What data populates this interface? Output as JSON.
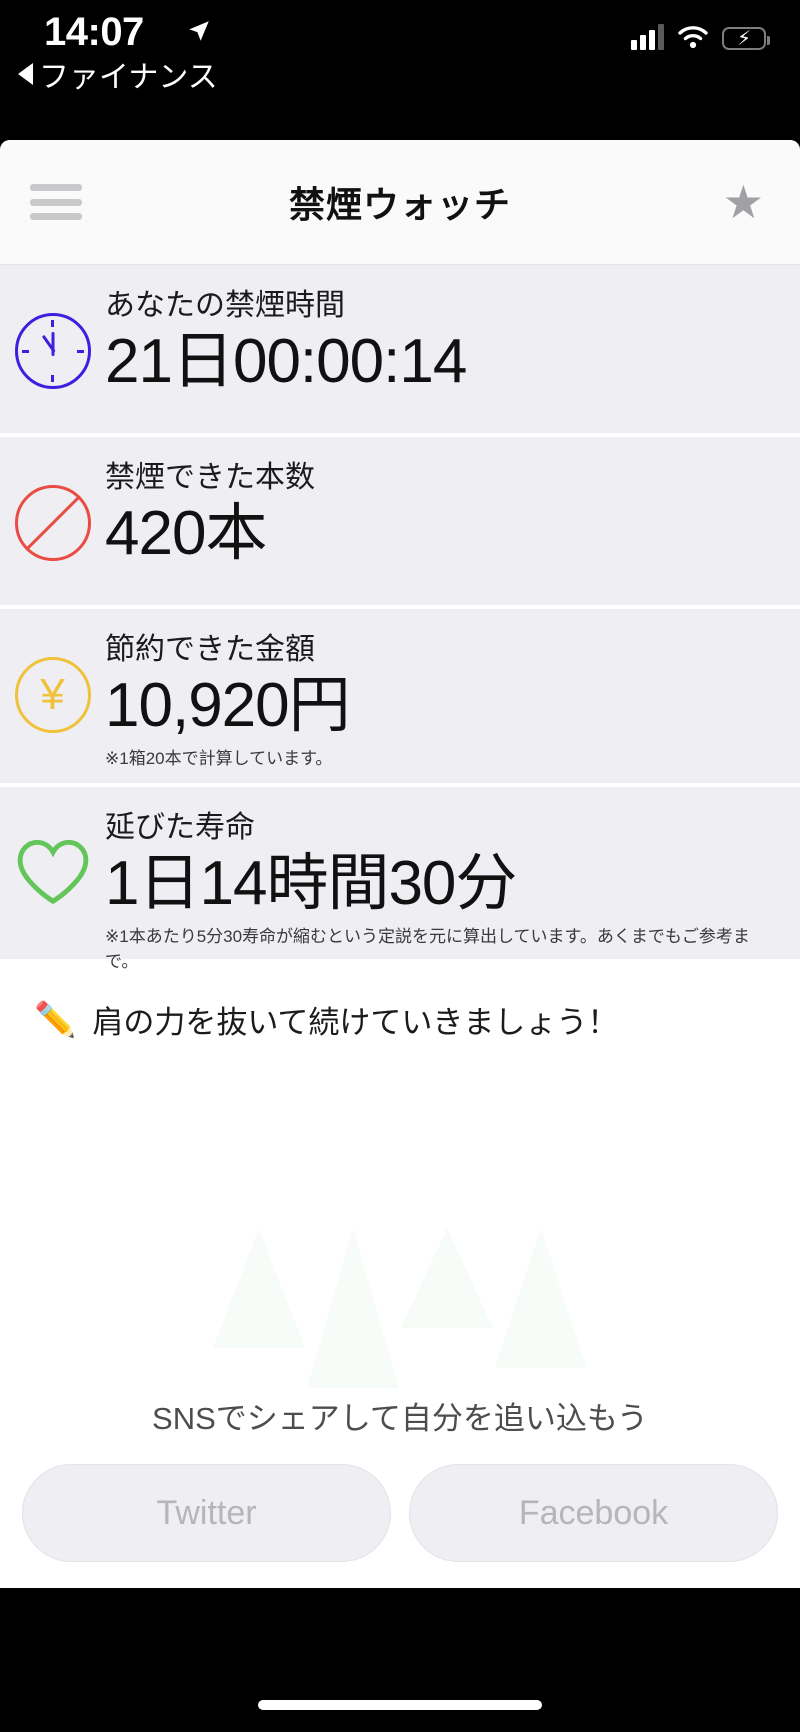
{
  "status_bar": {
    "time": "14:07",
    "location_icon": "location-arrow-icon",
    "back_label": "ファイナンス",
    "cellular_icon": "cellular-signal-icon",
    "wifi_icon": "wifi-icon",
    "battery_icon": "battery-charging-icon"
  },
  "app_bar": {
    "menu_icon": "hamburger-menu-icon",
    "title": "禁煙ウォッチ",
    "favorite_icon": "star-icon"
  },
  "stats": [
    {
      "icon": "clock-icon",
      "icon_color": "#3d1fe0",
      "label": "あなたの禁煙時間",
      "value": "21日00:00:14",
      "note": ""
    },
    {
      "icon": "no-smoking-icon",
      "icon_color": "#ea4b43",
      "label": "禁煙できた本数",
      "value": "420本",
      "note": ""
    },
    {
      "icon": "yen-icon",
      "icon_color": "#f0c23c",
      "label": "節約できた金額",
      "value": "10,920円",
      "note": "※1箱20本で計算しています。"
    },
    {
      "icon": "heart-icon",
      "icon_color": "#63c55a",
      "label": "延びた寿命",
      "value": "1日14時間30分",
      "note": "※1本あたり5分30寿命が縮むという定説を元に算出しています。あくまでもご参考まで。"
    }
  ],
  "message": {
    "icon": "pencil-icon",
    "glyph": "✏️",
    "text": "肩の力を抜いて続けていきましょう！"
  },
  "share": {
    "title": "SNSでシェアして自分を追い込もう",
    "buttons": [
      {
        "label": "Twitter"
      },
      {
        "label": "Facebook"
      }
    ]
  },
  "colors": {
    "row_background": "#eeeef3",
    "app_background": "#ffffff",
    "appbar_background": "#fafafa",
    "share_button": "#eeeef3"
  }
}
